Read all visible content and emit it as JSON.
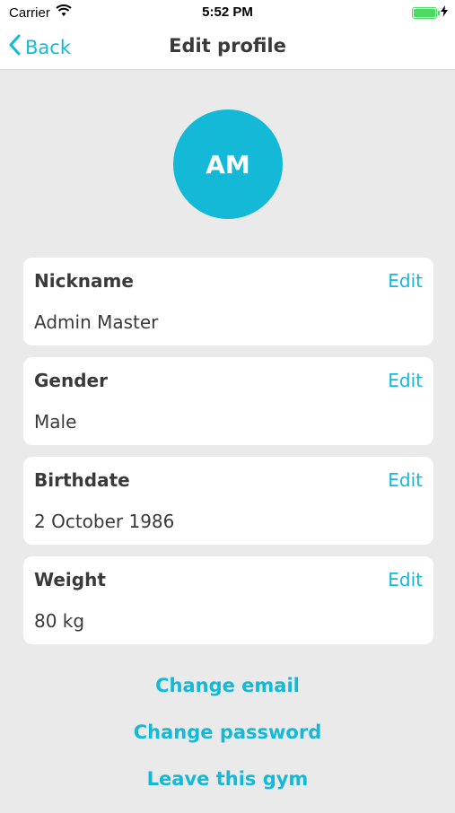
{
  "status": {
    "carrier": "Carrier",
    "time": "5:52 PM",
    "battery_level": 1.0
  },
  "nav": {
    "back_label": "Back",
    "title": "Edit profile"
  },
  "avatar": {
    "initials": "AM",
    "color": "#13b9d6"
  },
  "fields": [
    {
      "label": "Nickname",
      "value": "Admin Master",
      "edit": "Edit"
    },
    {
      "label": "Gender",
      "value": "Male",
      "edit": "Edit"
    },
    {
      "label": "Birthdate",
      "value": "2 October 1986",
      "edit": "Edit"
    },
    {
      "label": "Weight",
      "value": "80 kg",
      "edit": "Edit"
    }
  ],
  "links": {
    "change_email": "Change email",
    "change_password": "Change password",
    "leave_gym": "Leave this gym"
  },
  "colors": {
    "accent": "#13b9d6",
    "background": "#ebeaeb",
    "text": "#3a3a3a"
  }
}
